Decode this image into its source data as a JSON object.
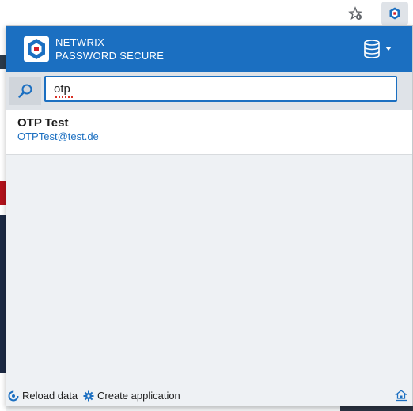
{
  "popup": {
    "brand": {
      "line1": "NETWRIX",
      "line2": "PASSWORD SECURE"
    },
    "search": {
      "value": "otp",
      "icon": "search-icon"
    },
    "results": [
      {
        "title": "OTP Test",
        "subtitle": "OTPTest@test.de"
      }
    ],
    "footer": {
      "reload_label": "Reload data",
      "create_label": "Create application"
    }
  },
  "colors": {
    "accent": "#1b6fc1",
    "header_bg": "#1b6fc1",
    "link": "#1b6fc1"
  }
}
